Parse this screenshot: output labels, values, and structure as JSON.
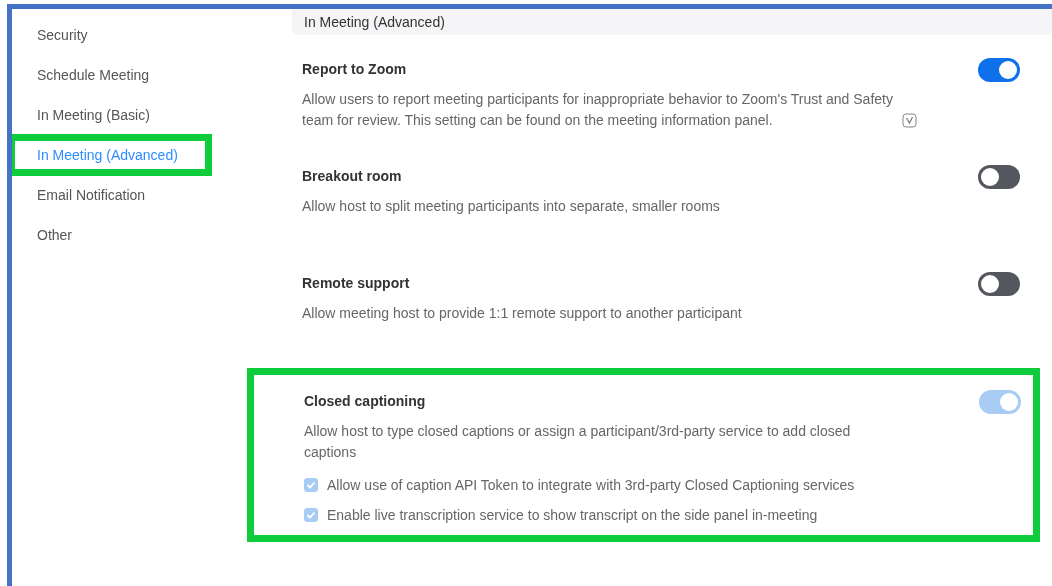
{
  "sidebar": {
    "items": [
      {
        "label": "Security",
        "selected": false,
        "highlighted": false
      },
      {
        "label": "Schedule Meeting",
        "selected": false,
        "highlighted": false
      },
      {
        "label": "In Meeting (Basic)",
        "selected": false,
        "highlighted": false
      },
      {
        "label": "In Meeting (Advanced)",
        "selected": true,
        "highlighted": true
      },
      {
        "label": "Email Notification",
        "selected": false,
        "highlighted": false
      },
      {
        "label": "Other",
        "selected": false,
        "highlighted": false
      }
    ]
  },
  "section": {
    "title": "In Meeting (Advanced)"
  },
  "settings": [
    {
      "title": "Report to Zoom",
      "description": "Allow users to report meeting participants for inappropriate behavior to Zoom's Trust and Safety team for review. This setting can be found on the meeting information panel.",
      "info_icon": true,
      "on": true,
      "highlighted": false
    },
    {
      "title": "Breakout room",
      "description": "Allow host to split meeting participants into separate, smaller rooms",
      "info_icon": false,
      "on": false,
      "highlighted": false
    },
    {
      "title": "Remote support",
      "description": "Allow meeting host to provide 1:1 remote support to another participant",
      "info_icon": false,
      "on": false,
      "highlighted": false
    },
    {
      "title": "Closed captioning",
      "description": "Allow host to type closed captions or assign a participant/3rd-party service to add closed captions",
      "info_icon": false,
      "on": true,
      "disabled": true,
      "highlighted": true,
      "options": [
        {
          "label": "Allow use of caption API Token to integrate with 3rd-party Closed Captioning services",
          "checked": true,
          "disabled": true
        },
        {
          "label": "Enable live transcription service to show transcript on the side panel in-meeting",
          "checked": true,
          "disabled": true
        }
      ]
    }
  ]
}
